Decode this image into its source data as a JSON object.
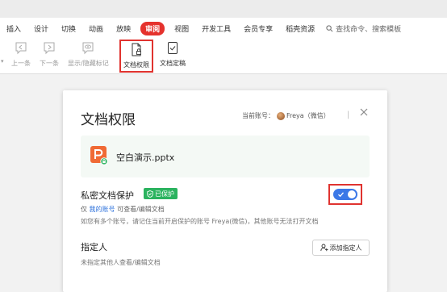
{
  "ribbon": {
    "tabs": [
      {
        "label": "插入"
      },
      {
        "label": "设计"
      },
      {
        "label": "切换"
      },
      {
        "label": "动画"
      },
      {
        "label": "放映"
      },
      {
        "label": "审阅",
        "active": true
      },
      {
        "label": "视图"
      },
      {
        "label": "开发工具"
      },
      {
        "label": "会员专享"
      },
      {
        "label": "稻壳资源"
      }
    ],
    "search_label": "查找命令、搜索模板",
    "active_tab_color": "#e5322d"
  },
  "toolbar": {
    "prev_label": "上一条",
    "next_label": "下一条",
    "show_hide_label": "显示/隐藏标记",
    "doc_permission_label": "文档权限",
    "doc_finalize_label": "文档定稿"
  },
  "dialog": {
    "title": "文档权限",
    "account_label": "当前账号：",
    "account_name": "Freya（微信）",
    "separator": "|",
    "file_name": "空白演示.pptx",
    "privacy_label": "私密文档保护",
    "protected_badge": "已保护",
    "privacy_enabled": true,
    "only_prefix": "仅",
    "my_account_link": "我的账号",
    "only_suffix": "可查看/编辑文档",
    "multi_account_note": "如您有多个账号，请记住当前开启保护的账号 Freya(微信)，其他账号无法打开文档",
    "assignee_label": "指定人",
    "add_assignee_button": "添加指定人",
    "unassigned_note": "未指定其他人查看/编辑文档",
    "badge_color": "#2bb35f",
    "toggle_color": "#3b78e7",
    "link_color": "#2a6fdb"
  }
}
